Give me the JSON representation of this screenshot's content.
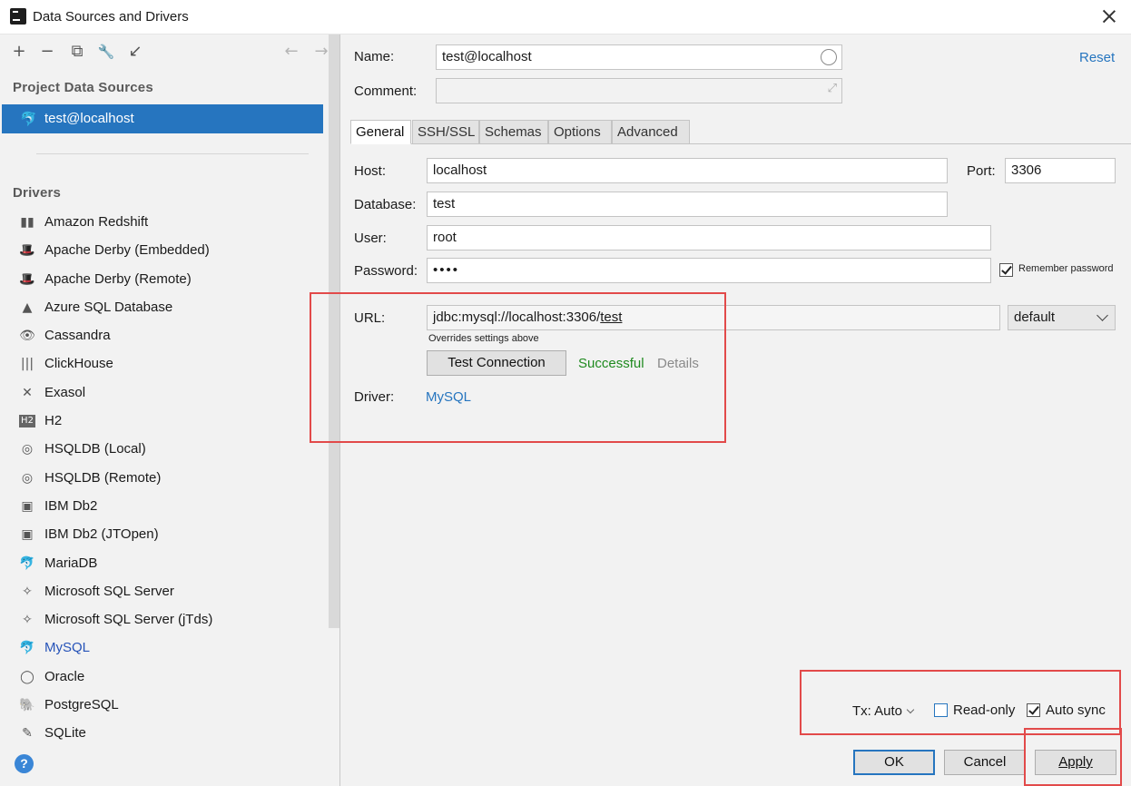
{
  "window": {
    "title": "Data Sources and Drivers"
  },
  "left": {
    "toolbar": {
      "add": "+",
      "remove": "−",
      "duplicate": "⧉",
      "properties": "🔧",
      "import": "↙",
      "back": "←",
      "forward": "→"
    },
    "project_title": "Project Data Sources",
    "selected_source": "test@localhost",
    "drivers_title": "Drivers",
    "drivers": [
      {
        "label": "Amazon Redshift",
        "icon": "▮▮"
      },
      {
        "label": "Apache Derby (Embedded)",
        "icon": "🎩"
      },
      {
        "label": "Apache Derby (Remote)",
        "icon": "🎩"
      },
      {
        "label": "Azure SQL Database",
        "icon": "▲"
      },
      {
        "label": "Cassandra",
        "icon": "👁"
      },
      {
        "label": "ClickHouse",
        "icon": "|||"
      },
      {
        "label": "Exasol",
        "icon": "✕"
      },
      {
        "label": "H2",
        "icon": "H2"
      },
      {
        "label": "HSQLDB (Local)",
        "icon": "◎"
      },
      {
        "label": "HSQLDB (Remote)",
        "icon": "◎"
      },
      {
        "label": "IBM Db2",
        "icon": "▣"
      },
      {
        "label": "IBM Db2 (JTOpen)",
        "icon": "▣"
      },
      {
        "label": "MariaDB",
        "icon": "🐬"
      },
      {
        "label": "Microsoft SQL Server",
        "icon": "✧"
      },
      {
        "label": "Microsoft SQL Server (jTds)",
        "icon": "✧"
      },
      {
        "label": "MySQL",
        "icon": "🐬"
      },
      {
        "label": "Oracle",
        "icon": "◯"
      },
      {
        "label": "PostgreSQL",
        "icon": "🐘"
      },
      {
        "label": "SQLite",
        "icon": "✎"
      }
    ],
    "help": "?"
  },
  "form": {
    "name_label": "Name:",
    "name_value": "test@localhost",
    "comment_label": "Comment:",
    "comment_value": "",
    "reset": "Reset",
    "tabs": [
      "General",
      "SSH/SSL",
      "Schemas",
      "Options",
      "Advanced"
    ],
    "host_label": "Host:",
    "host_value": "localhost",
    "port_label": "Port:",
    "port_value": "3306",
    "database_label": "Database:",
    "database_value": "test",
    "user_label": "User:",
    "user_value": "root",
    "password_label": "Password:",
    "password_value": "••••",
    "remember_password": "Remember password",
    "url_label": "URL:",
    "url_prefix": "jdbc:mysql://localhost:3306/",
    "url_db": "test",
    "url_mode": "default",
    "url_hint": "Overrides settings above",
    "test_connection": "Test Connection",
    "test_status": "Successful",
    "details": "Details",
    "driver_label": "Driver:",
    "driver_value": "MySQL"
  },
  "footer": {
    "tx_label": "Tx: Auto",
    "read_only": "Read-only",
    "auto_sync": "Auto sync",
    "ok": "OK",
    "cancel": "Cancel",
    "apply": "Apply"
  },
  "colors": {
    "accent": "#2675bf",
    "success": "#1f8a1f",
    "highlight": "#e24a4a"
  }
}
